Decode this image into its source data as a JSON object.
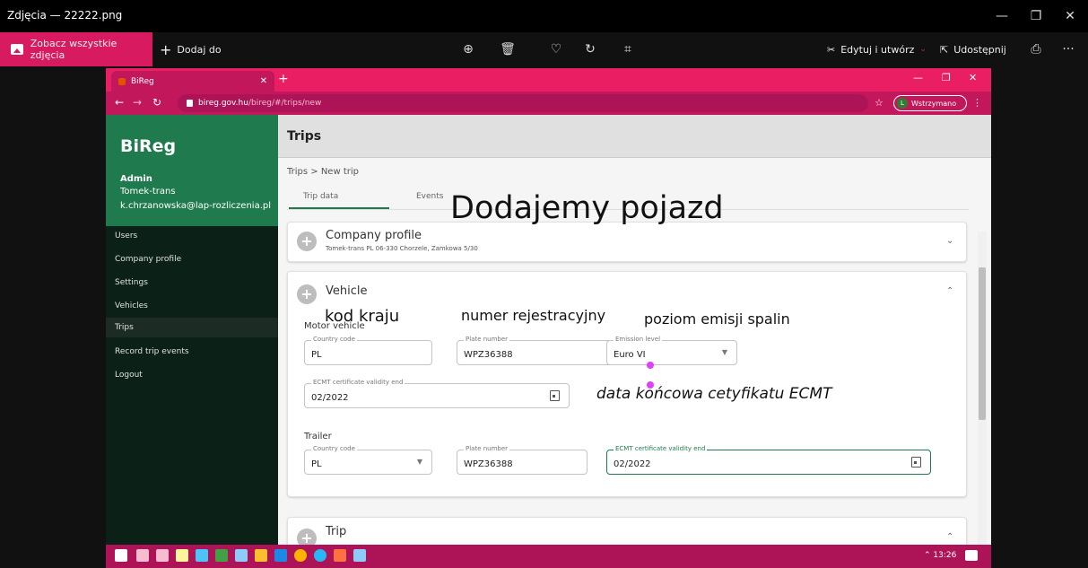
{
  "window": {
    "title": "Zdjęcia — 22222.png",
    "controls": [
      "—",
      "❐",
      "✕"
    ]
  },
  "photo_toolbar": {
    "see_all": "Zobacz wszystkie zdjęcia",
    "add_to": "Dodaj do",
    "edit_create": "Edytuj i utwórz",
    "share": "Udostępnij",
    "more": "···"
  },
  "browser": {
    "tab_title": "BiReg",
    "tab_close": "✕",
    "new_tab": "+",
    "url_domain": "bireg.gov.hu",
    "url_path": "/bireg/#/trips/new",
    "profile_initial": "L",
    "profile_status": "Wstrzymano"
  },
  "sidebar": {
    "brand": "BiReg",
    "role": "Admin",
    "company": "Tomek-trans",
    "email": "k.chrzanowska@lap-rozliczenia.pl",
    "items": [
      {
        "label": "Users"
      },
      {
        "label": "Company profile"
      },
      {
        "label": "Settings"
      },
      {
        "label": "Vehicles"
      },
      {
        "label": "Trips"
      },
      {
        "label": "Record trip events"
      },
      {
        "label": "Logout"
      }
    ]
  },
  "main": {
    "header": "Trips",
    "breadcrumb": "Trips  >  New trip",
    "tabs": [
      "Trip data",
      "Events"
    ]
  },
  "company_card": {
    "title": "Company profile",
    "subtitle": "Tomek-trans PL 06-330 Chorzele, Zamkowa 5/30"
  },
  "vehicle_card": {
    "title": "Vehicle",
    "motor_section": "Motor vehicle",
    "trailer_section": "Trailer",
    "motor": {
      "country_label": "Country code",
      "country_value": "PL",
      "plate_label": "Plate number",
      "plate_value": "WPZ36388",
      "emission_label": "Emission level",
      "emission_value": "Euro VI",
      "ecmt_label": "ECMT certificate validity end",
      "ecmt_value": "02/2022"
    },
    "trailer": {
      "country_label": "Country code",
      "country_value": "PL",
      "plate_label": "Plate number",
      "plate_value": "WPZ36388",
      "ecmt_label": "ECMT certificate validity end",
      "ecmt_value": "02/2022"
    }
  },
  "trip_card": {
    "title": "Trip"
  },
  "annotations": {
    "heading": "Dodajemy pojazd",
    "country": "kod kraju",
    "plate": "numer rejestracyjny",
    "emission": "poziom emisji spalin",
    "ecmt": "data końcowa cetyfikatu ECMT"
  },
  "taskbar": {
    "clock": "13:26"
  },
  "colors": {
    "accent_pink": "#e91e63",
    "brand_green": "#1f7a4d"
  }
}
